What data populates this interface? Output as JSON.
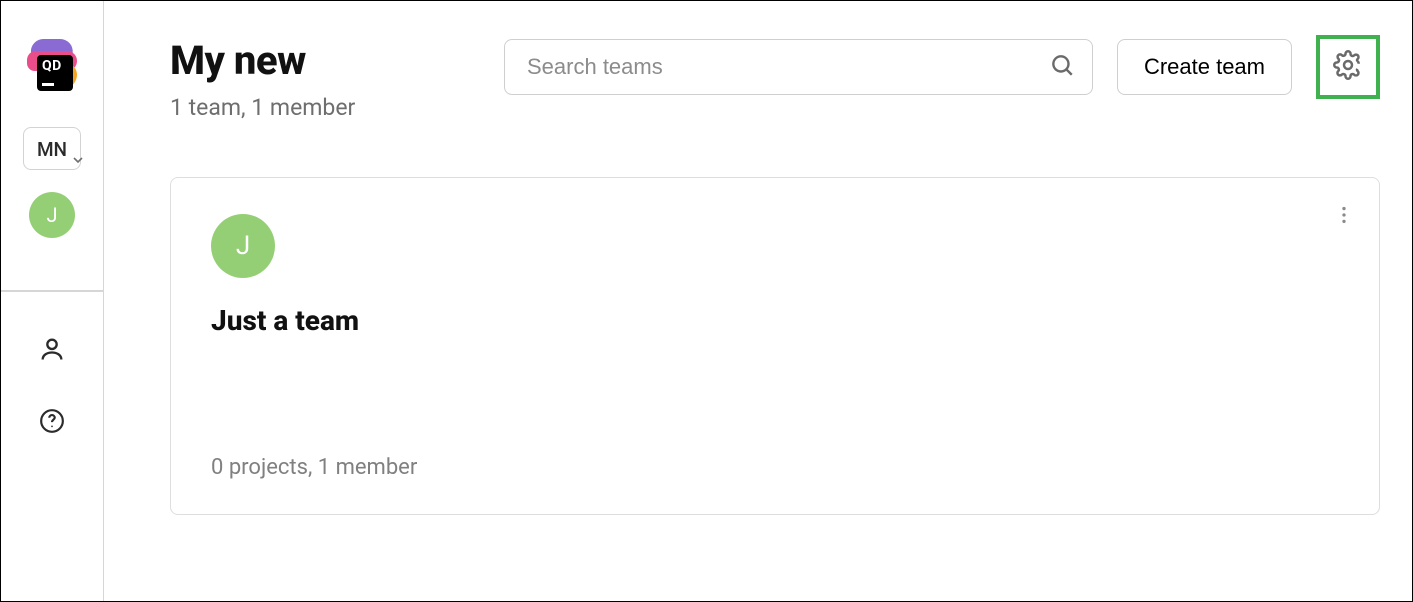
{
  "sidebar": {
    "logo_text": "QD",
    "org_chip": "MN",
    "user_avatar_letter": "J"
  },
  "header": {
    "title": "My new",
    "subtitle": "1 team, 1 member",
    "search_placeholder": "Search teams",
    "create_button": "Create team"
  },
  "teams": [
    {
      "avatar_letter": "J",
      "name": "Just a team",
      "meta": "0 projects, 1 member"
    }
  ],
  "colors": {
    "accent_green": "#3fb24f",
    "avatar_green": "#94cf76"
  }
}
